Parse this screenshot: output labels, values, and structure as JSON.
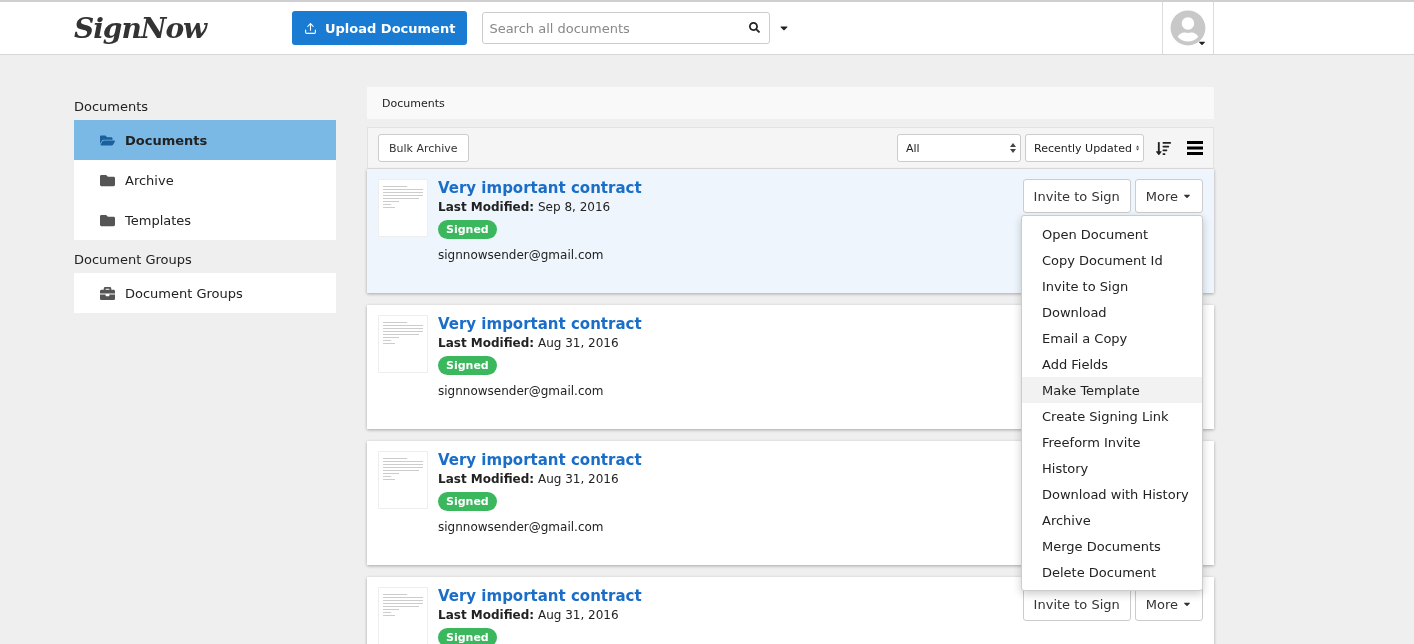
{
  "header": {
    "logo": "SignNow",
    "upload_button": "Upload Document",
    "search": {
      "placeholder": "Search all documents"
    }
  },
  "sidebar": {
    "sections": [
      {
        "heading": "Documents",
        "items": [
          {
            "label": "Documents",
            "kind": "open",
            "selected": true
          },
          {
            "label": "Archive",
            "kind": "folder",
            "selected": false
          },
          {
            "label": "Templates",
            "kind": "folder",
            "selected": false
          }
        ]
      },
      {
        "heading": "Document Groups",
        "items": [
          {
            "label": "Document Groups",
            "kind": "group",
            "selected": false
          }
        ]
      }
    ]
  },
  "breadcrumb": "Documents",
  "toolbar": {
    "bulk_button": "Bulk Archive",
    "filter": "All",
    "sort": "Recently Updated"
  },
  "documents": [
    {
      "title": "Very important contract",
      "modified_label": "Last Modified:",
      "modified_date": "Sep 8, 2016",
      "status": "Signed",
      "email": "signnowsender@gmail.com",
      "selected": true,
      "actions": [
        "Invite to Sign",
        "More"
      ],
      "menu": [
        {
          "label": "Open Document",
          "highlighted": false
        },
        {
          "label": "Copy Document Id",
          "highlighted": false
        },
        {
          "label": "Invite to Sign",
          "highlighted": false
        },
        {
          "label": "Download",
          "highlighted": false
        },
        {
          "label": "Email a Copy",
          "highlighted": false
        },
        {
          "label": "Add Fields",
          "highlighted": false
        },
        {
          "label": "Make Template",
          "highlighted": true
        },
        {
          "label": "Create Signing Link",
          "highlighted": false
        },
        {
          "label": "Freeform Invite",
          "highlighted": false
        },
        {
          "label": "History",
          "highlighted": false
        },
        {
          "label": "Download with History",
          "highlighted": false
        },
        {
          "label": "Archive",
          "highlighted": false
        },
        {
          "label": "Merge Documents",
          "highlighted": false
        },
        {
          "label": "Delete Document",
          "highlighted": false
        }
      ]
    },
    {
      "title": "Very important contract",
      "modified_label": "Last Modified:",
      "modified_date": "Aug 31, 2016",
      "status": "Signed",
      "email": "signnowsender@gmail.com",
      "selected": false
    },
    {
      "title": "Very important contract",
      "modified_label": "Last Modified:",
      "modified_date": "Aug 31, 2016",
      "status": "Signed",
      "email": "signnowsender@gmail.com",
      "selected": false
    },
    {
      "title": "Very important contract",
      "modified_label": "Last Modified:",
      "modified_date": "Aug 31, 2016",
      "status": "Signed",
      "selected": false,
      "actions": [
        "Invite to Sign",
        "More"
      ]
    }
  ]
}
